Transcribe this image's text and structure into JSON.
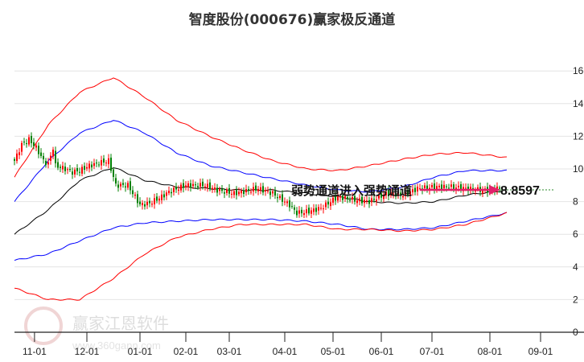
{
  "chart_data": {
    "type": "candlestick-channel",
    "title": "智度股份(000676)赢家极反通道",
    "ylim": [
      0,
      16.5
    ],
    "yticks": [
      0,
      2,
      4,
      6,
      8,
      10,
      12,
      14,
      16
    ],
    "xlim": [
      0,
      224
    ],
    "xticks": [
      {
        "label": "11-01",
        "day": 8.3
      },
      {
        "label": "12-01",
        "day": 30
      },
      {
        "label": "01-01",
        "day": 52
      },
      {
        "label": "02-01",
        "day": 71
      },
      {
        "label": "03-01",
        "day": 89
      },
      {
        "label": "04-01",
        "day": 112
      },
      {
        "label": "05-01",
        "day": 132
      },
      {
        "label": "06-01",
        "day": 152
      },
      {
        "label": "07-01",
        "day": 173
      },
      {
        "label": "08-01",
        "day": 197
      },
      {
        "label": "09-01",
        "day": 218
      }
    ],
    "price_path": [
      [
        0,
        10.5
      ],
      [
        3,
        11.5
      ],
      [
        6,
        11.8
      ],
      [
        9,
        11.3
      ],
      [
        12,
        10.5
      ],
      [
        14,
        10.3
      ],
      [
        16,
        11.3
      ],
      [
        17,
        10.2
      ],
      [
        21,
        10
      ],
      [
        24,
        9.8
      ],
      [
        27,
        9.9
      ],
      [
        31,
        10.2
      ],
      [
        36,
        10.4
      ],
      [
        39,
        10.5
      ],
      [
        42,
        9.0
      ],
      [
        47,
        9.0
      ],
      [
        52,
        7.8
      ],
      [
        56,
        7.9
      ],
      [
        61,
        8.3
      ],
      [
        64,
        8.6
      ],
      [
        71,
        9.0
      ],
      [
        79,
        9.0
      ],
      [
        84,
        8.7
      ],
      [
        91,
        8.5
      ],
      [
        101,
        8.8
      ],
      [
        107,
        8.5
      ],
      [
        114,
        7.8
      ],
      [
        117,
        7.3
      ],
      [
        122,
        7.4
      ],
      [
        127,
        7.6
      ],
      [
        134,
        8.3
      ],
      [
        141,
        8.1
      ],
      [
        147,
        8.0
      ],
      [
        154,
        8.5
      ],
      [
        161,
        8.4
      ],
      [
        167,
        8.8
      ],
      [
        174,
        8.9
      ],
      [
        181,
        8.9
      ],
      [
        187,
        8.8
      ],
      [
        194,
        8.7
      ],
      [
        199,
        8.7
      ],
      [
        201,
        8.86
      ]
    ],
    "series": [
      {
        "name": "red-upper",
        "color": "#ff0000",
        "points": [
          [
            0,
            9.5
          ],
          [
            14,
            12.7
          ],
          [
            27,
            14.7
          ],
          [
            41,
            15.6
          ],
          [
            54,
            14.4
          ],
          [
            67,
            13.0
          ],
          [
            81,
            12.0
          ],
          [
            94,
            11.2
          ],
          [
            107,
            10.5
          ],
          [
            121,
            10.0
          ],
          [
            134,
            9.9
          ],
          [
            147,
            10.2
          ],
          [
            161,
            10.6
          ],
          [
            174,
            10.9
          ],
          [
            187,
            11.0
          ],
          [
            204,
            10.7
          ]
        ]
      },
      {
        "name": "blue-upper",
        "color": "#0000ff",
        "points": [
          [
            0,
            8.0
          ],
          [
            14,
            10.5
          ],
          [
            27,
            12.2
          ],
          [
            41,
            13.0
          ],
          [
            54,
            12.2
          ],
          [
            67,
            11.0
          ],
          [
            81,
            10.2
          ],
          [
            94,
            9.8
          ],
          [
            107,
            9.4
          ],
          [
            121,
            9.0
          ],
          [
            134,
            8.7
          ],
          [
            147,
            8.6
          ],
          [
            161,
            8.9
          ],
          [
            174,
            9.5
          ],
          [
            187,
            9.9
          ],
          [
            204,
            9.9
          ]
        ]
      },
      {
        "name": "middle",
        "color": "#000000",
        "points": [
          [
            0,
            6.0
          ],
          [
            14,
            7.5
          ],
          [
            27,
            9.3
          ],
          [
            41,
            10.1
          ],
          [
            54,
            9.3
          ],
          [
            67,
            8.9
          ],
          [
            81,
            8.8
          ],
          [
            94,
            8.7
          ],
          [
            107,
            8.7
          ],
          [
            121,
            8.5
          ],
          [
            134,
            8.3
          ],
          [
            147,
            8.0
          ],
          [
            161,
            7.9
          ],
          [
            174,
            8.0
          ],
          [
            187,
            8.4
          ],
          [
            204,
            8.7
          ]
        ]
      },
      {
        "name": "blue-lower",
        "color": "#0000ff",
        "points": [
          [
            0,
            4.4
          ],
          [
            14,
            4.8
          ],
          [
            27,
            5.6
          ],
          [
            41,
            6.4
          ],
          [
            54,
            6.7
          ],
          [
            67,
            6.8
          ],
          [
            81,
            6.9
          ],
          [
            94,
            6.9
          ],
          [
            107,
            6.9
          ],
          [
            121,
            6.8
          ],
          [
            134,
            6.6
          ],
          [
            147,
            6.3
          ],
          [
            161,
            6.3
          ],
          [
            174,
            6.4
          ],
          [
            187,
            6.8
          ],
          [
            204,
            7.3
          ]
        ]
      },
      {
        "name": "red-lower",
        "color": "#ff0000",
        "points": [
          [
            0,
            2.7
          ],
          [
            14,
            2.0
          ],
          [
            27,
            2.0
          ],
          [
            41,
            3.3
          ],
          [
            54,
            4.8
          ],
          [
            67,
            5.8
          ],
          [
            81,
            6.3
          ],
          [
            94,
            6.6
          ],
          [
            107,
            6.6
          ],
          [
            121,
            6.6
          ],
          [
            134,
            6.3
          ],
          [
            147,
            6.3
          ],
          [
            161,
            6.2
          ],
          [
            174,
            6.3
          ],
          [
            187,
            6.6
          ],
          [
            204,
            7.3
          ]
        ]
      }
    ],
    "annotation": "弱势通道进入强势通道",
    "last_value": "8.8597",
    "up_color": "#ff0000",
    "down_color": "#008000",
    "arrow_color": "#e0206a"
  },
  "watermark": {
    "name": "赢家江恩软件",
    "url": "www.360gann.com",
    "seal": "江赢恩家"
  }
}
